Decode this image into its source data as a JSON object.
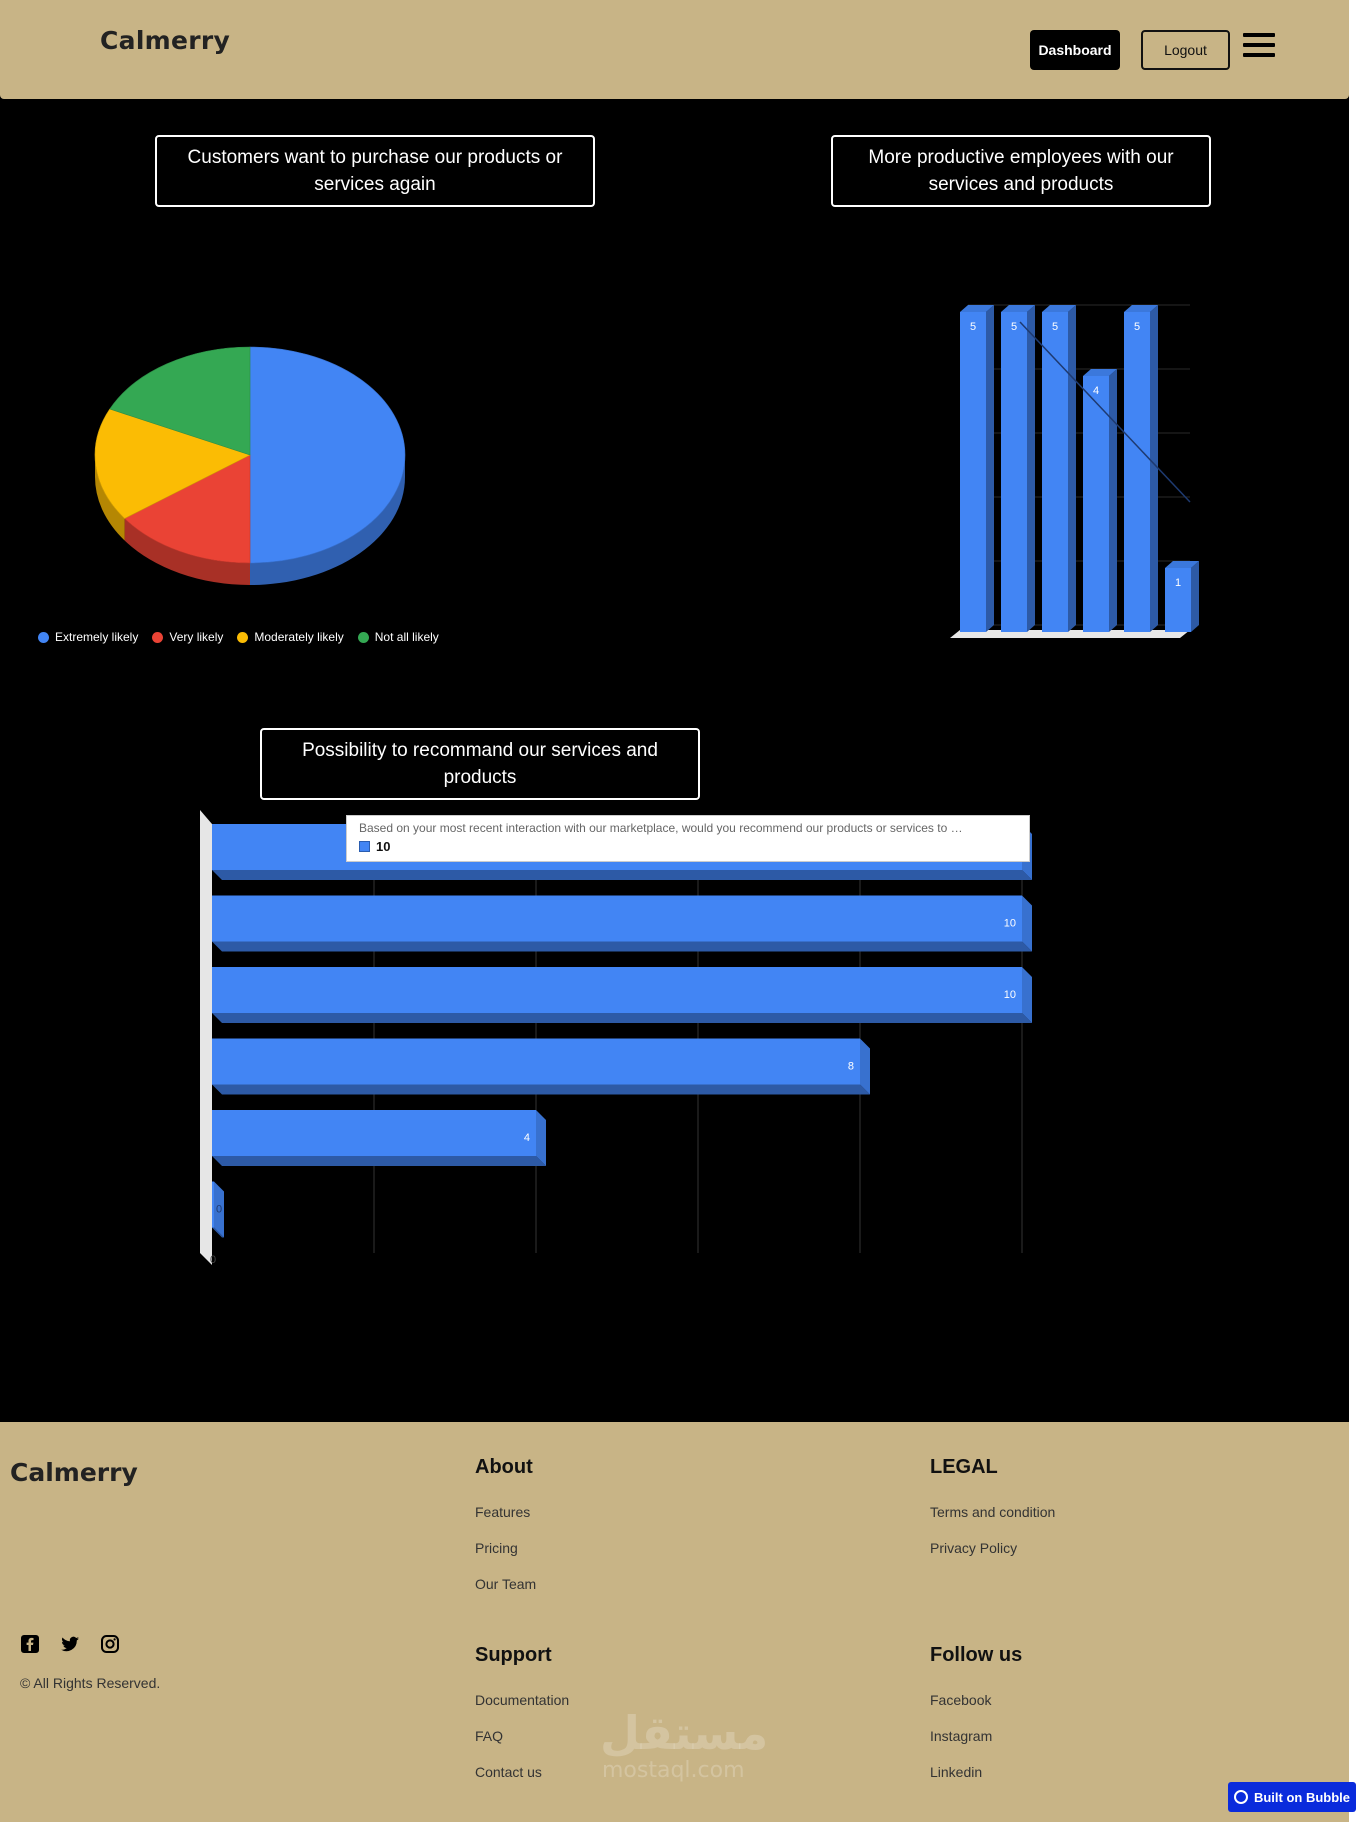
{
  "header": {
    "brand": "Calmerry",
    "dashboard_label": "Dashboard",
    "logout_label": "Logout"
  },
  "charts": {
    "pie_title": "Customers want to purchase our products or services again",
    "column_title": "More productive employees with our services and products",
    "bar_title": "Possibility to recommand our services and products"
  },
  "chart_data": [
    {
      "type": "pie",
      "title": "Customers want to purchase our products or services again",
      "categories": [
        "Extremely likely",
        "Very likely",
        "Moderately likely",
        "Not all likely"
      ],
      "values": [
        50,
        15,
        17,
        18
      ],
      "colors": [
        "#4285f4",
        "#ea4335",
        "#fbbc04",
        "#34a853"
      ],
      "legend": "bottom-left"
    },
    {
      "type": "bar",
      "title": "More productive employees with our services and products",
      "values": [
        5,
        5,
        5,
        4,
        5,
        1
      ],
      "ylim": [
        0,
        5
      ],
      "grid": true,
      "colors": [
        "#4285f4"
      ]
    },
    {
      "type": "bar",
      "orientation": "horizontal",
      "title": "Possibility to recommand our services and products",
      "values": [
        10,
        10,
        10,
        8,
        4,
        0
      ],
      "xlim": [
        0,
        10
      ],
      "axis_min_label": "0",
      "grid": true,
      "colors": [
        "#4285f4"
      ],
      "tooltip": {
        "text": "Based on your most recent interaction with our marketplace, would you recommend our products or services to …",
        "value": "10"
      }
    }
  ],
  "footer": {
    "brand": "Calmerry",
    "about_heading": "About",
    "about_links": [
      "Features",
      "Pricing",
      "Our Team"
    ],
    "legal_heading": "LEGAL",
    "legal_links": [
      "Terms and condition",
      "Privacy Policy"
    ],
    "support_heading": "Support",
    "support_links": [
      "Documentation",
      "FAQ",
      "Contact us"
    ],
    "follow_heading": "Follow us",
    "follow_links": [
      "Facebook",
      "Instagram",
      "Linkedin"
    ],
    "social_icons": [
      "facebook-icon",
      "twitter-icon",
      "instagram-icon"
    ],
    "rights": "© All Rights Reserved.",
    "watermark": "مستقل",
    "watermark_sub": "mostaql.com"
  },
  "bubble_badge": "Built on Bubble"
}
